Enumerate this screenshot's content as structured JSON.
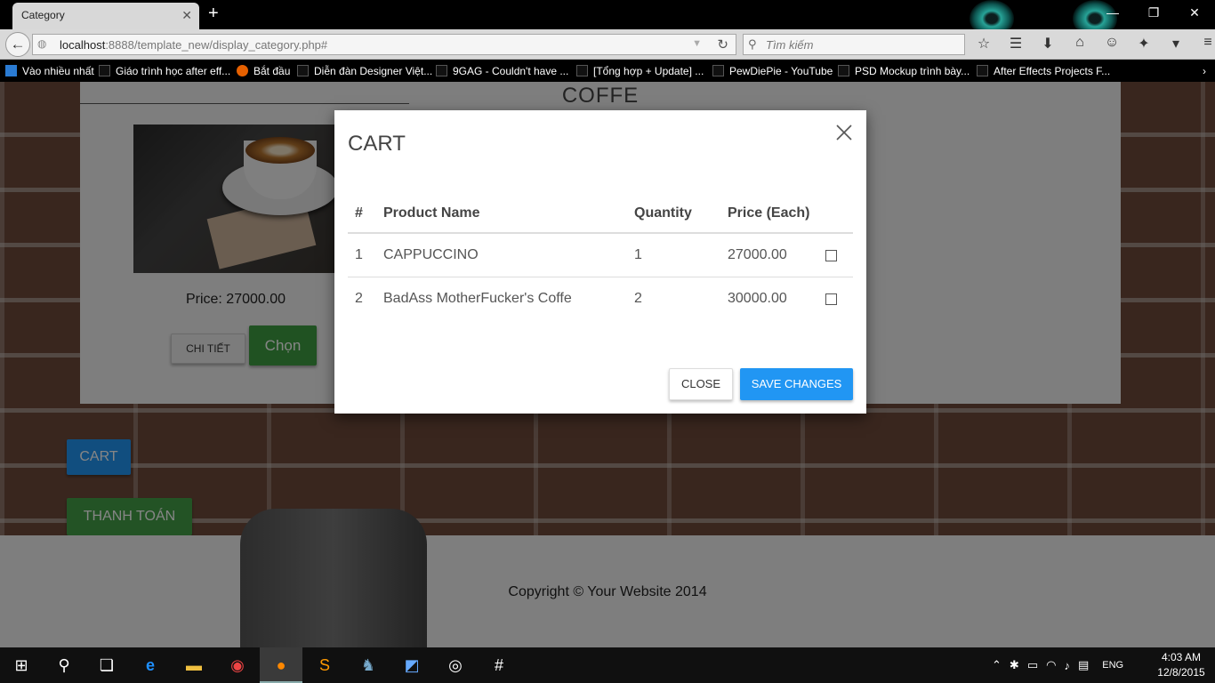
{
  "browser": {
    "tab_title": "Category",
    "url_host": "localhost",
    "url_rest": ":8888/template_new/display_category.php#",
    "search_placeholder": "Tìm kiếm",
    "bookmarks": [
      "Vào nhiều nhất",
      "Giáo trình học after eff...",
      "Bắt đầu",
      "Diễn đàn Designer Việt...",
      "9GAG - Couldn't have ...",
      "[Tổng hợp + Update] ...",
      "PewDiePie - YouTube",
      "PSD Mockup trình bày...",
      "After Effects Projects F..."
    ]
  },
  "page": {
    "category_title": "COFFE",
    "product": {
      "price_label": "Price: 27000.00",
      "detail_button": "CHI TIẾT",
      "choose_button": "Chọn"
    },
    "cart_button": "CART",
    "checkout_button": "THANH TOÁN",
    "footer": "Copyright © Your Website 2014"
  },
  "modal": {
    "title": "CART",
    "columns": [
      "#",
      "Product Name",
      "Quantity",
      "Price (Each)"
    ],
    "rows": [
      {
        "num": "1",
        "name": "CAPPUCCINO",
        "qty": "1",
        "price": "27000.00"
      },
      {
        "num": "2",
        "name": "BadAss MotherFucker's Coffe",
        "qty": "2",
        "price": "30000.00"
      }
    ],
    "close_button": "CLOSE",
    "save_button": "SAVE CHANGES"
  },
  "taskbar": {
    "language": "ENG",
    "time": "4:03 AM",
    "date": "12/8/2015"
  },
  "colors": {
    "primary_blue": "#2196f3",
    "success_green": "#43a047",
    "choose_green": "#3e9e41"
  }
}
